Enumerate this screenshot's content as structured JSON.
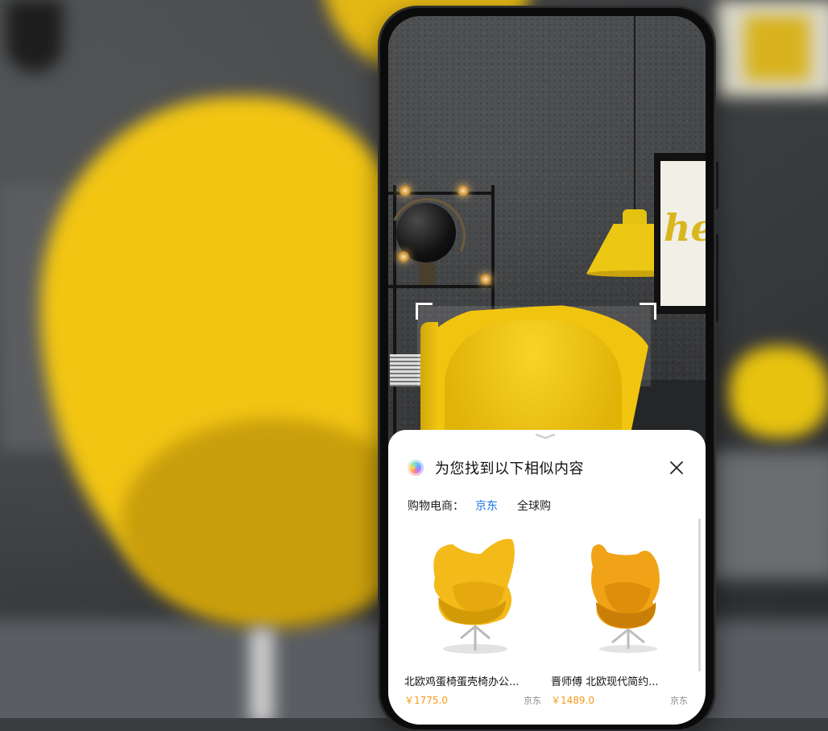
{
  "sheet": {
    "title": "为您找到以下相似内容",
    "filter_label": "购物电商：",
    "tabs": [
      {
        "label": "京东",
        "active": true
      },
      {
        "label": "全球购",
        "active": false
      }
    ]
  },
  "results": [
    {
      "title": "北欧鸡蛋椅蛋壳椅办公...",
      "price": "￥1775.0",
      "source": "京东"
    },
    {
      "title": "晋师傅 北欧现代简约...",
      "price": "￥1489.0",
      "source": "京东"
    }
  ],
  "scene": {
    "frame_text": "he"
  },
  "colors": {
    "accent_blue": "#1a73e8",
    "price_orange": "#f29b18",
    "chair_yellow": "#f1c50f"
  },
  "icons": {
    "assistant": "ai-assistant-icon",
    "close": "close-icon",
    "handle": "chevron-down-icon"
  }
}
